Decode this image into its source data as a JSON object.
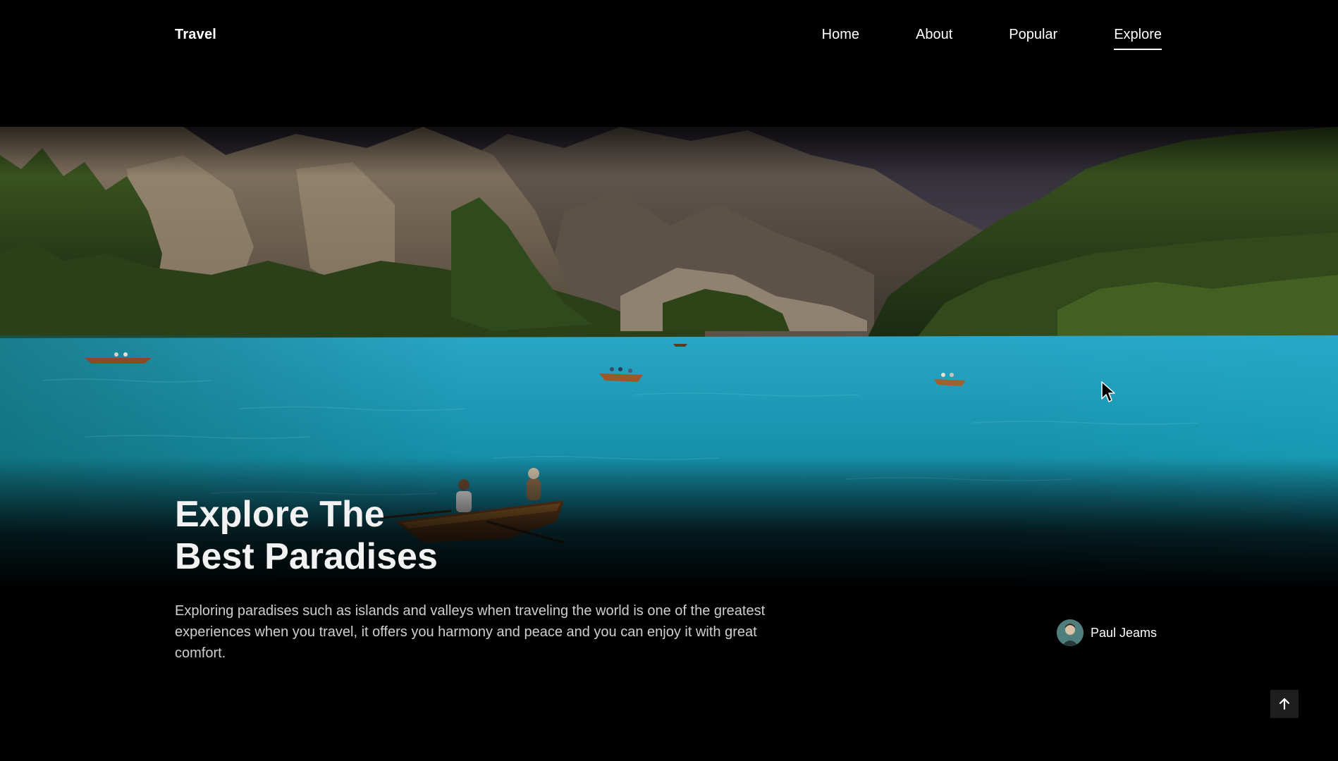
{
  "header": {
    "logo": "Travel",
    "nav": [
      {
        "label": "Home",
        "active": false
      },
      {
        "label": "About",
        "active": false
      },
      {
        "label": "Popular",
        "active": false
      },
      {
        "label": "Explore",
        "active": true
      }
    ]
  },
  "hero": {
    "title_line1": "Explore The",
    "title_line2": "Best Paradises",
    "description": "Exploring paradises such as islands and valleys when traveling the world is one of the greatest experiences when you travel, it offers you harmony and peace and you can enjoy it with great comfort.",
    "background_icon": "lake-mountain-landscape-image"
  },
  "author": {
    "name": "Paul Jeams",
    "avatar_icon": "user-avatar"
  },
  "scroll_up": {
    "icon": "arrow-up-icon"
  },
  "colors": {
    "background": "#000000",
    "text": "#ffffff",
    "description": "#cfcfcf",
    "water": "#1a9bb5"
  }
}
